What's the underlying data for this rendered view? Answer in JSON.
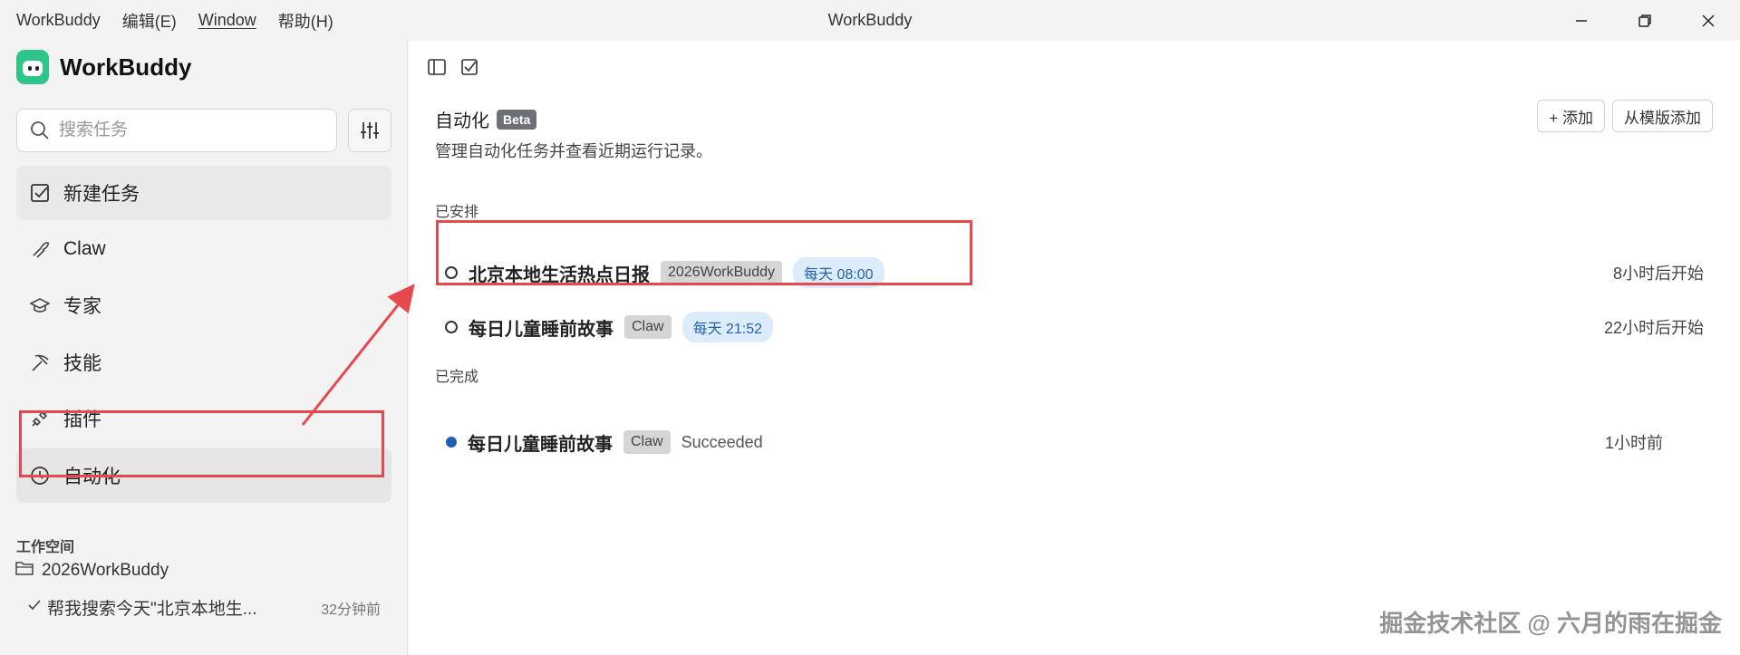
{
  "menu": {
    "app": "WorkBuddy",
    "edit": "编辑(E)",
    "window": "Window",
    "help": "帮助(H)"
  },
  "window_title": "WorkBuddy",
  "sidebar": {
    "brand": "WorkBuddy",
    "search_placeholder": "搜索任务",
    "items": [
      {
        "label": "新建任务",
        "icon": "checkbox-icon"
      },
      {
        "label": "Claw",
        "icon": "claw-icon"
      },
      {
        "label": "专家",
        "icon": "graduation-cap-icon"
      },
      {
        "label": "技能",
        "icon": "pickaxe-icon"
      },
      {
        "label": "插件",
        "icon": "plug-icon"
      },
      {
        "label": "自动化",
        "icon": "clock-icon"
      }
    ],
    "workspace_title": "工作空间",
    "workspace_folder": "2026WorkBuddy",
    "workspace_task": {
      "title": "帮我搜索今天\"北京本地生...",
      "time": "32分钟前"
    }
  },
  "main": {
    "title": "自动化",
    "beta": "Beta",
    "description": "管理自动化任务并查看近期运行记录。",
    "add_button": "+ 添加",
    "template_button": "从模版添加",
    "scheduled_title": "已安排",
    "scheduled": [
      {
        "name": "北京本地生活热点日报",
        "tag": "2026WorkBuddy",
        "schedule": "每天 08:00",
        "eta": "8小时后开始"
      },
      {
        "name": "每日儿童睡前故事",
        "tag": "Claw",
        "schedule": "每天 21:52",
        "eta": "22小时后开始"
      }
    ],
    "completed_title": "已完成",
    "completed": [
      {
        "name": "每日儿童睡前故事",
        "tag": "Claw",
        "status": "Succeeded",
        "time": "1小时前"
      }
    ]
  },
  "watermark": "掘金技术社区 @ 六月的雨在掘金",
  "colors": {
    "accent_red": "#e5484d",
    "brand_green": "#2ec58a",
    "tag_blue": "#2562a8"
  }
}
